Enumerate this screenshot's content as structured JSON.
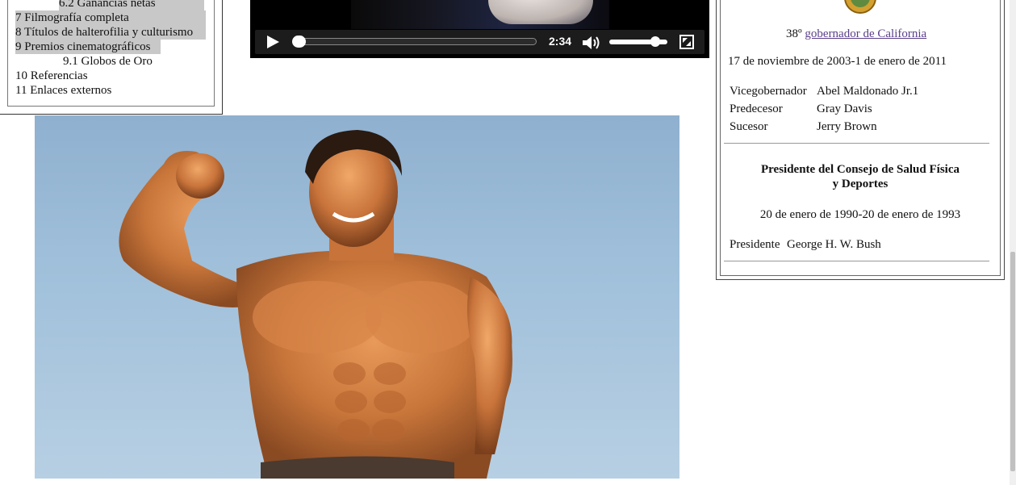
{
  "toc": {
    "items": [
      {
        "label": "6.2 Ganancias netas",
        "highlighted": true
      },
      {
        "label": "7 Filmografía completa",
        "highlighted": true
      },
      {
        "label": "8 Títulos de halterofilia y culturismo",
        "highlighted": true
      },
      {
        "label": "9 Premios cinematográficos",
        "highlighted": true
      },
      {
        "label": "9.1 Globos de Oro",
        "highlighted": false
      },
      {
        "label": "10 Referencias",
        "highlighted": false
      },
      {
        "label": "11 Enlaces externos",
        "highlighted": false
      }
    ]
  },
  "video": {
    "time": "2:34",
    "progress": 0.0,
    "volume": 0.85,
    "icons": {
      "play": "play-icon",
      "volume": "volume-icon",
      "fullscreen": "fullscreen-icon"
    }
  },
  "infobox": {
    "governor_ordinal": "38º",
    "governor_link": "gobernador de California",
    "governor_dates": "17 de noviembre de 2003-1 de enero de 2011",
    "rows": [
      {
        "label": "Vicegobernador",
        "value": "Abel Maldonado Jr.1"
      },
      {
        "label": "Predecesor",
        "value": "Gray Davis"
      },
      {
        "label": "Sucesor",
        "value": "Jerry Brown"
      }
    ],
    "council_title_line1": "Presidente del Consejo de Salud Física",
    "council_title_line2": "y Deportes",
    "council_dates": "20 de enero de 1990-20 de enero de 1993",
    "president_label": "Presidente",
    "president_value": "George H. W. Bush"
  },
  "colors": {
    "link": "#5a3e8a",
    "toc_highlight": "#c8c8c8",
    "video_bg": "#000000"
  }
}
